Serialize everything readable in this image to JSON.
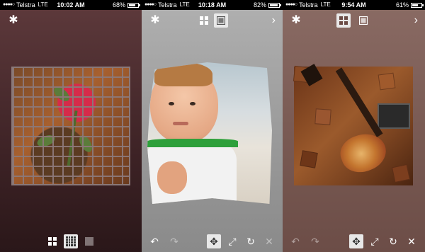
{
  "panels": [
    {
      "status": {
        "carrier": "Telstra",
        "network": "LTE",
        "time": "10:02 AM",
        "battery": "68%",
        "battery_level": 0.68
      },
      "topbar": {
        "gear_icon": "gear-icon"
      },
      "bottombar": {
        "icons": [
          "grid-2x2-icon",
          "grid-4x4-icon",
          "square-icon"
        ],
        "selected": 1
      }
    },
    {
      "status": {
        "carrier": "Telstra",
        "network": "LTE",
        "time": "10:18 AM",
        "battery": "82%",
        "battery_level": 0.82
      },
      "topbar": {
        "gear_icon": "gear-icon",
        "modes": [
          "grid-2x2-icon",
          "square-icon"
        ],
        "selected_mode": 1,
        "next_icon": "chevron-right-icon"
      },
      "bottombar": {
        "icons": [
          "undo-icon",
          "redo-icon",
          "move-icon",
          "resize-icon",
          "rotate-icon",
          "close-icon"
        ],
        "selected": 2
      }
    },
    {
      "status": {
        "carrier": "Telstra",
        "network": "LTE",
        "time": "9:54 AM",
        "battery": "61%",
        "battery_level": 0.61
      },
      "topbar": {
        "gear_icon": "gear-icon",
        "modes": [
          "grid-2x2-icon",
          "square-icon"
        ],
        "selected_mode": 0,
        "next_icon": "chevron-right-icon"
      },
      "bottombar": {
        "icons": [
          "undo-icon",
          "redo-icon",
          "move-icon",
          "resize-icon",
          "rotate-icon",
          "close-icon"
        ],
        "selected": 2
      }
    }
  ],
  "glyphs": {
    "gear": "✱",
    "chevron_right": "›",
    "undo": "↶",
    "redo": "↷",
    "move": "✥",
    "resize": "⤢",
    "rotate": "↻",
    "close": "✕",
    "signal": "●●●●○"
  },
  "colors": {
    "panel1_bg": "#4a2c2f",
    "panel2_bg": "#9e9e9e",
    "panel3_bg": "#7a5b54",
    "selected_button": "#e8e8e8"
  }
}
